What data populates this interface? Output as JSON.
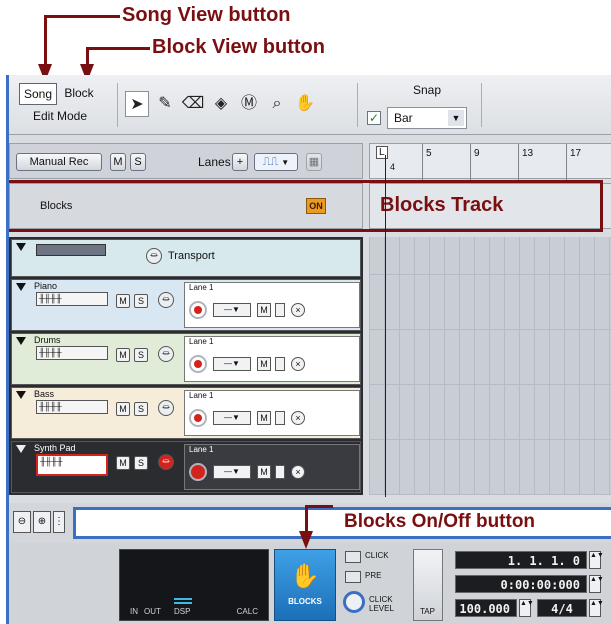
{
  "callouts": {
    "song_view": "Song View button",
    "block_view": "Block View button",
    "blocks_track": "Blocks Track",
    "blocks_onoff": "Blocks On/Off button"
  },
  "toolbar": {
    "song_label": "Song",
    "block_label": "Block",
    "edit_mode_label": "Edit Mode",
    "snap_label": "Snap",
    "snap_value": "Bar",
    "snap_checked": "✓"
  },
  "header": {
    "manual_rec": "Manual Rec",
    "m": "M",
    "s": "S",
    "lanes_label": "Lanes",
    "plus": "+"
  },
  "ruler": {
    "ticks": [
      "5",
      "9",
      "13",
      "17"
    ],
    "locator_l": "L",
    "locator_4": "4"
  },
  "blocks_track": {
    "label": "Blocks",
    "on_label": "ON"
  },
  "tracks": [
    {
      "name": "Transport",
      "type": "transport"
    },
    {
      "name": "Piano",
      "lane": "Lane 1",
      "color": "#d8e7f2"
    },
    {
      "name": "Drums",
      "lane": "Lane 1",
      "color": "#e0ecd7"
    },
    {
      "name": "Bass",
      "lane": "Lane 1",
      "color": "#f5ecd9"
    },
    {
      "name": "Synth Pad",
      "lane": "Lane 1",
      "color": "#2b2c30"
    }
  ],
  "track_buttons": {
    "m": "M",
    "s": "S",
    "x": "×"
  },
  "transport": {
    "dsp_in": "IN",
    "dsp_out": "OUT",
    "dsp_label": "DSP",
    "calc": "CALC",
    "blocks_label": "BLOCKS",
    "click": "CLICK",
    "pre": "PRE",
    "click_level": "CLICK LEVEL",
    "tap": "TAP",
    "position": "1. 1. 1.  0",
    "time": "0:00:00:000",
    "tempo": "100.000",
    "signature": "4/4"
  }
}
